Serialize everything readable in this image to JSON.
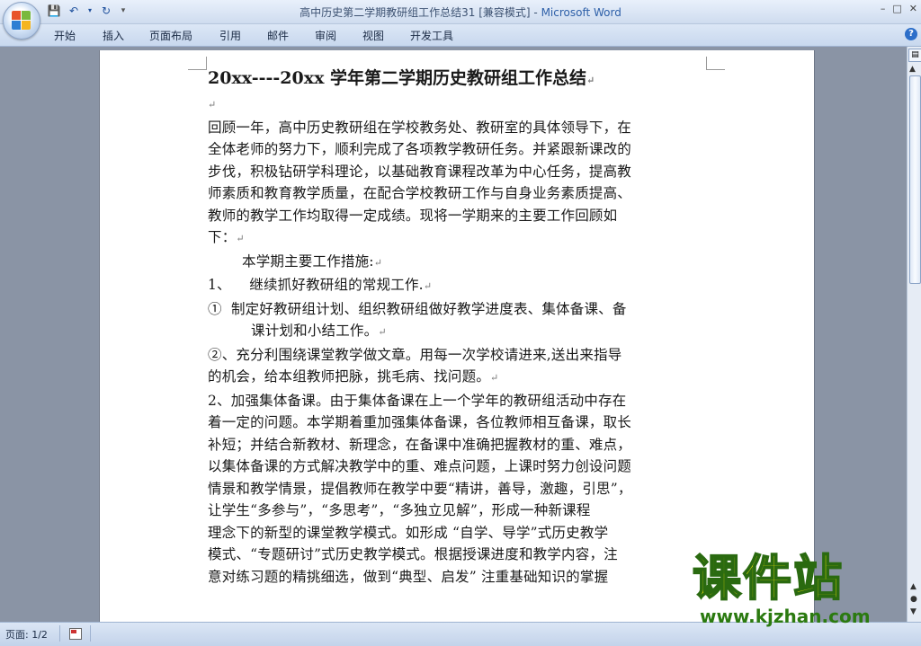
{
  "window": {
    "title": "高中历史第二学期教研组工作总结31 [兼容模式]",
    "title_sep": " - ",
    "app_name": "Microsoft Word"
  },
  "ribbon": {
    "tabs": [
      "开始",
      "插入",
      "页面布局",
      "引用",
      "邮件",
      "审阅",
      "视图",
      "开发工具"
    ]
  },
  "document": {
    "heading": "20xx----20xx 学年第二学期历史教研组工作总结",
    "lines": [
      "回顾一年，高中历史教研组在学校教务处、教研室的具体领导下，在",
      "全体老师的努力下，顺利完成了各项教学教研任务。并紧跟新课改的",
      "步伐，积极钻研学科理论，以基础教育课程改革为中心任务，提高教",
      "师素质和教育教学质量，在配合学校教研工作与自身业务素质提高、",
      "教师的教学工作均取得一定成绩。现将一学期来的主要工作回顾如",
      "下：",
      "本学期主要工作措施:",
      "1、    继续抓好教研组的常规工作.",
      "①  制定好教研组计划、组织教研组做好教学进度表、集体备课、备",
      "课计划和小结工作。",
      "②、充分利围绕课堂教学做文章。用每一次学校请进来,送出来指导",
      "的机会，给本组教师把脉，挑毛病、找问题。",
      "2、加强集体备课。由于集体备课在上一个学年的教研组活动中存在",
      "着一定的问题。本学期着重加强集体备课，各位教师相互备课，取长",
      "补短；并结合新教材、新理念，在备课中准确把握教材的重、难点，",
      "以集体备课的方式解决教学中的重、难点问题，上课时努力创设问题",
      "情景和教学情景，提倡教师在教学中要“精讲，善导，激趣，引思”，",
      "让学生“多参与”，“多思考”，“多独立见解”，形成一种新课程",
      "理念下的新型的课堂教学模式。如形成 “自学、导学”式历史教学",
      "模式、“专题研讨”式历史教学模式。根据授课进度和教学内容，注",
      "意对练习题的精挑细选，做到“典型、启发” 注重基础知识的掌握"
    ]
  },
  "status": {
    "page": "页面: 1/2"
  },
  "watermark": {
    "main": "课件站",
    "url": "www.kjzhan.com"
  },
  "colors": {
    "title_app": "#2d5fa8",
    "workspace": "#8a94a5",
    "watermark_fill": "#f2e60a",
    "watermark_stroke": "#2a6a10"
  }
}
